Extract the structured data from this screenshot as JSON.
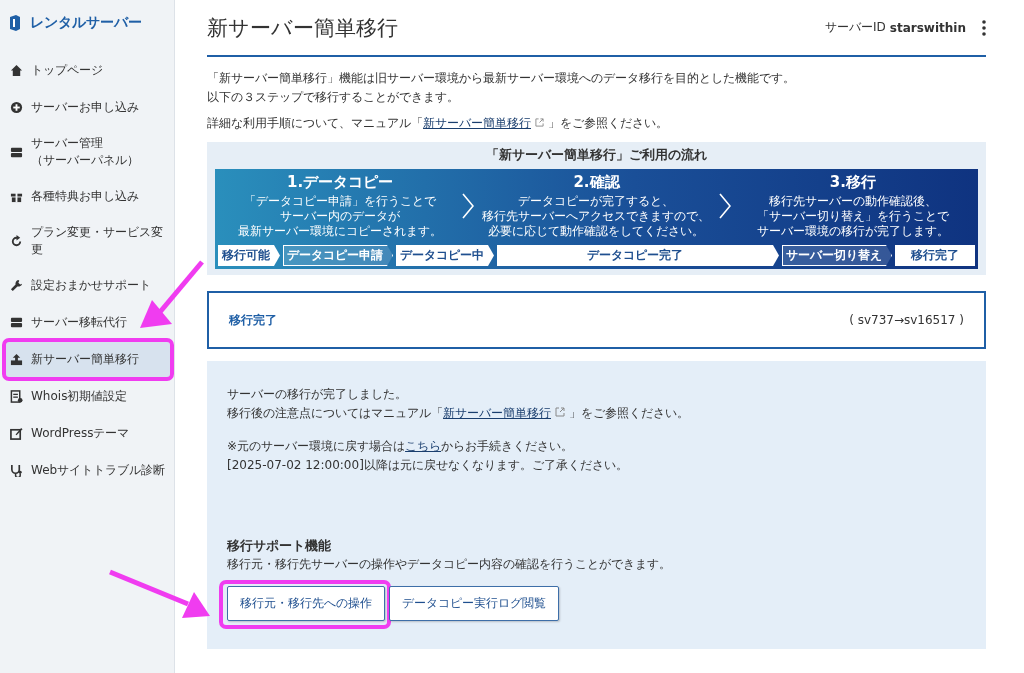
{
  "sidebar": {
    "logo": "レンタルサーバー",
    "items": [
      {
        "label": "トップページ",
        "selected": false
      },
      {
        "label": "サーバーお申し込み",
        "selected": false
      },
      {
        "label": "サーバー管理",
        "sub": "（サーバーパネル）",
        "selected": false
      },
      {
        "label": "各種特典お申し込み",
        "selected": false
      },
      {
        "label": "プラン変更・サービス変更",
        "selected": false
      },
      {
        "label": "設定おまかせサポート",
        "selected": false
      },
      {
        "label": "サーバー移転代行",
        "selected": false
      },
      {
        "label": "新サーバー簡単移行",
        "selected": true
      },
      {
        "label": "Whois初期値設定",
        "selected": false
      },
      {
        "label": "WordPressテーマ",
        "selected": false
      },
      {
        "label": "Webサイトトラブル診断",
        "selected": false
      }
    ]
  },
  "header": {
    "title": "新サーバー簡単移行",
    "server_id_label": "サーバーID",
    "server_id": "starswithin"
  },
  "intro": [
    "「新サーバー簡単移行」機能は旧サーバー環境から最新サーバー環境へのデータ移行を目的とした機能です。",
    "以下の３ステップで移行することができます。"
  ],
  "manual_note": {
    "before": "詳細な利用手順について、マニュアル「",
    "link": "新サーバー簡単移行",
    "after": "」をご参照ください。"
  },
  "flow": {
    "title": "「新サーバー簡単移行」ご利用の流れ",
    "steps": [
      {
        "title": "1.データコピー",
        "lines": [
          "「データコピー申請」を行うことで",
          "サーバー内のデータが",
          "最新サーバー環境にコピーされます。"
        ]
      },
      {
        "title": "2.確認",
        "lines": [
          "データコピーが完了すると、",
          "移行先サーバーへアクセスできますので、",
          "必要に応じて動作確認をしてください。"
        ]
      },
      {
        "title": "3.移行",
        "lines": [
          "移行先サーバーの動作確認後、",
          "「サーバー切り替え」を行うことで",
          "サーバー環境の移行が完了します。"
        ]
      }
    ],
    "stages": [
      {
        "label": "移行可能",
        "kind": "filled"
      },
      {
        "label": "データコピー申請",
        "kind": "outline"
      },
      {
        "label": "データコピー中",
        "kind": "filled"
      },
      {
        "label": "データコピー完了",
        "kind": "wide"
      },
      {
        "label": "サーバー切り替え",
        "kind": "outline"
      },
      {
        "label": "移行完了",
        "kind": "end"
      }
    ]
  },
  "status": {
    "label": "移行完了",
    "servers": "( sv737→sv16517 )"
  },
  "info": {
    "line1": "サーバーの移行が完了しました。",
    "manual": {
      "before": "移行後の注意点についてはマニュアル「",
      "link": "新サーバー簡単移行",
      "after": "」をご参照ください。"
    },
    "revert": {
      "before": "※元のサーバー環境に戻す場合は",
      "link": "こちら",
      "after": "からお手続きください。"
    },
    "deadline": "[2025-07-02 12:00:00]以降は元に戻せなくなります。ご了承ください。",
    "support_title": "移行サポート機能",
    "support_text": "移行元・移行先サーバーの操作やデータコピー内容の確認を行うことができます。",
    "buttons": [
      "移行元・移行先への操作",
      "データコピー実行ログ閲覧"
    ]
  }
}
